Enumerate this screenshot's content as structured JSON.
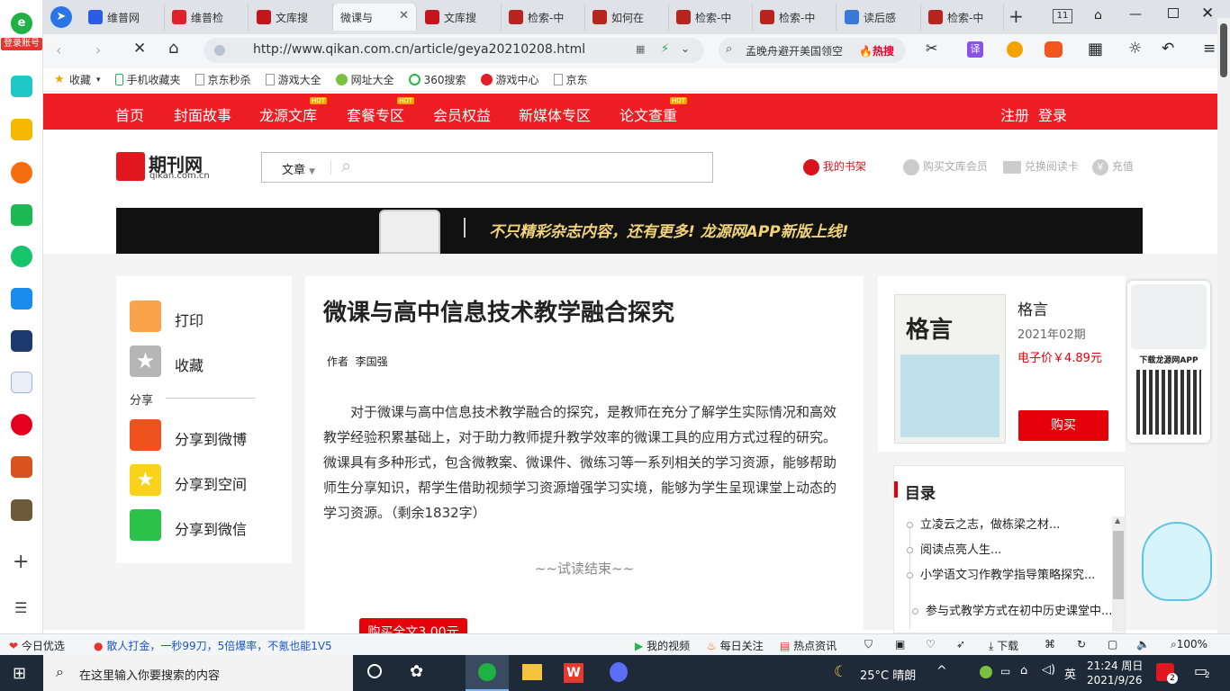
{
  "browser": {
    "tabs": [
      {
        "label": "维普网",
        "icon": "baidu-paw-icon",
        "color": "#2b5ce6"
      },
      {
        "label": "维普检",
        "icon": "weipu-icon",
        "color": "#e0202a"
      },
      {
        "label": "文库搜",
        "icon": "longyuan-icon",
        "color": "#c4151c"
      },
      {
        "label": "微课与",
        "icon": "",
        "color": "",
        "active": true
      },
      {
        "label": "文库搜",
        "icon": "longyuan-icon",
        "color": "#c4151c"
      },
      {
        "label": "检索-中",
        "icon": "zhi-icon",
        "color": "#b8251e"
      },
      {
        "label": "如何在",
        "icon": "zhi-icon",
        "color": "#b8251e"
      },
      {
        "label": "检索-中",
        "icon": "zhi-icon",
        "color": "#b8251e"
      },
      {
        "label": "检索-中",
        "icon": "zhi-icon",
        "color": "#b8251e"
      },
      {
        "label": "读后感",
        "icon": "doc-icon",
        "color": "#3a78d8"
      },
      {
        "label": "检索-中",
        "icon": "zhi-icon",
        "color": "#b8251e"
      }
    ],
    "tab_count": "11",
    "url": "http://www.qikan.com.cn/article/geya20210208.html",
    "search_text": "孟晚舟避开美国领空",
    "search_badge": "热搜",
    "bookmarks": [
      "收藏",
      "手机收藏夹",
      "京东秒杀",
      "游戏大全",
      "网址大全",
      "360搜索",
      "游戏中心",
      "京东"
    ],
    "login_label": "登录账号"
  },
  "site": {
    "nav": [
      {
        "label": "首页",
        "hot": ""
      },
      {
        "label": "封面故事",
        "hot": ""
      },
      {
        "label": "龙源文库",
        "hot": "HOT"
      },
      {
        "label": "套餐专区",
        "hot": "HOT"
      },
      {
        "label": "会员权益",
        "hot": ""
      },
      {
        "label": "新媒体专区",
        "hot": ""
      },
      {
        "label": "论文查重",
        "hot": "HOT"
      }
    ],
    "register": "注册",
    "login": "登录",
    "logo_cn": "期刊网",
    "logo_en": "qikan.com.cn",
    "search_type": "文章",
    "my_shelf": "我的书架",
    "buy_member": "购买文库会员",
    "redeem_card": "兑换阅读卡",
    "recharge": "充值",
    "banner_text": "不只精彩杂志内容，还有更多! 龙源网APP新版上线!"
  },
  "sidepanel": {
    "print": "打印",
    "favorite": "收藏",
    "share_title": "分享",
    "share_weibo": "分享到微博",
    "share_qzone": "分享到空间",
    "share_wechat": "分享到微信"
  },
  "article": {
    "title": "微课与高中信息技术教学融合探究",
    "author_label": "作者",
    "author": "李国强",
    "body": "对于微课与高中信息技术教学融合的探究，是教师在充分了解学生实际情况和高效教学经验积累基础上，对于助力教师提升教学效率的微课工具的应用方式过程的研究。微课具有多种形式，包含微教案、微课件、微练习等一系列相关的学习资源，能够帮助师生分享知识，帮学生借助视频学习资源增强学习实境，能够为学生呈现课堂上动态的学习资源。（剩余1832字）",
    "trial_end": "~~试读结束~~",
    "buy_full": "购买全文3.00元"
  },
  "magazine": {
    "name": "格言",
    "issue": "2021年02期",
    "price": "电子价￥4.89元",
    "buy": "购买",
    "app_download": "下载龙源网APP"
  },
  "toc": {
    "title": "目录",
    "items": [
      "立凌云之志，做栋梁之材...",
      "阅读点亮人生...",
      "小学语文习作教学指导策略探究...",
      "参与式教学方式在初中历史课堂中..."
    ]
  },
  "statusbar": {
    "today": "今日优选",
    "ad": "散人打金，一秒99刀，5倍爆率，不氪也能1V5",
    "video": "我的视频",
    "daily": "每日关注",
    "hot": "热点资讯",
    "download": "下载",
    "zoom": "100%"
  },
  "taskbar": {
    "search_placeholder": "在这里输入你要搜索的内容",
    "weather": "25°C 晴朗",
    "ime": "英",
    "time": "21:24 周日",
    "date": "2021/9/26",
    "notif1": "2",
    "notif2": "2"
  }
}
